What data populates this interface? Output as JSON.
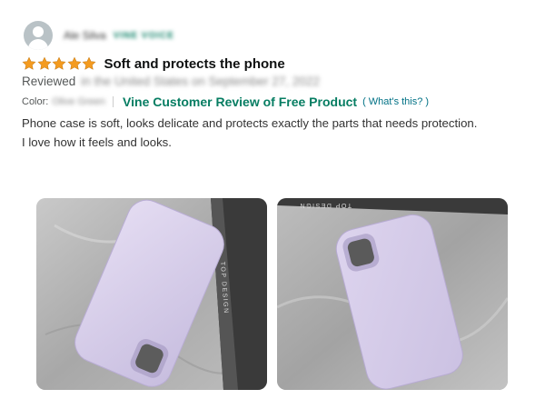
{
  "reviewer": {
    "name": "Ale Silva",
    "badge": "VINE VOICE"
  },
  "review": {
    "rating": 5,
    "rating_max": 5,
    "title": "Soft and protects the phone",
    "reviewed_label": "Reviewed",
    "reviewed_date": "in the United States on September 27, 2022",
    "color_label": "Color:",
    "color_value": "Olive Green",
    "vine_label": "Vine Customer Review of Free Product",
    "whats_this": "( What's this? )",
    "body_line1": "Phone case is soft, looks delicate and protects exactly the parts that needs protection.",
    "body_line2": "I love how it feels and looks."
  },
  "photos": [
    {
      "overlay_text": "TOP DESIGN"
    },
    {
      "overlay_text": "TOP DESIGN"
    }
  ],
  "colors": {
    "star": "#f49b1f",
    "vine_green": "#067d62",
    "link": "#007185",
    "case_lavender": "#d3cbe6"
  }
}
